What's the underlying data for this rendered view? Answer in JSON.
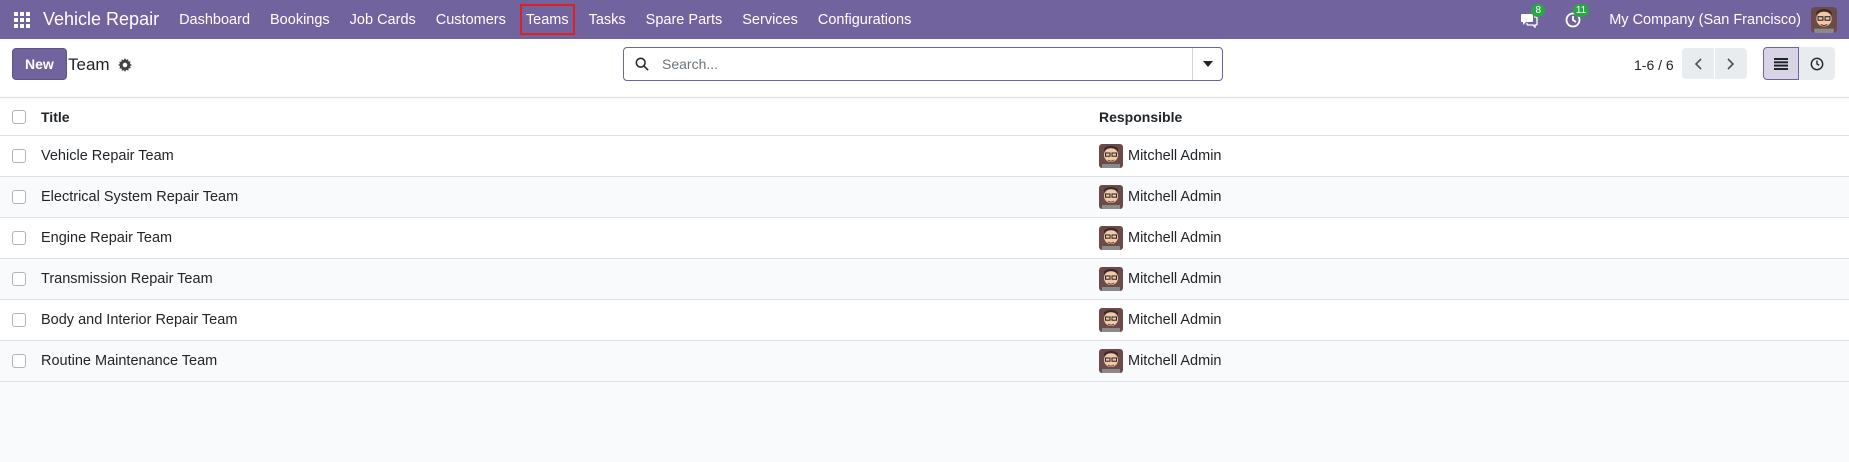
{
  "navbar": {
    "brand": "Vehicle Repair",
    "menu": [
      "Dashboard",
      "Bookings",
      "Job Cards",
      "Customers",
      "Teams",
      "Tasks",
      "Spare Parts",
      "Services",
      "Configurations"
    ],
    "messages_count": "8",
    "activities_count": "11",
    "company": "My Company (San Francisco)"
  },
  "control_panel": {
    "new_label": "New",
    "breadcrumb": "Team",
    "search_placeholder": "Search...",
    "pager": "1-6 / 6"
  },
  "list": {
    "columns": {
      "title": "Title",
      "responsible": "Responsible"
    },
    "rows": [
      {
        "title": "Vehicle Repair Team",
        "responsible": "Mitchell Admin"
      },
      {
        "title": "Electrical System Repair Team",
        "responsible": "Mitchell Admin"
      },
      {
        "title": "Engine Repair Team",
        "responsible": "Mitchell Admin"
      },
      {
        "title": "Transmission Repair Team",
        "responsible": "Mitchell Admin"
      },
      {
        "title": "Body and Interior Repair Team",
        "responsible": "Mitchell Admin"
      },
      {
        "title": "Routine Maintenance Team",
        "responsible": "Mitchell Admin"
      }
    ]
  },
  "colors": {
    "primary": "#71639e",
    "highlight": "#e02020",
    "badge": "#28a745"
  },
  "icons": [
    "apps-grid-icon",
    "chat-icon",
    "clock-icon",
    "gear-icon",
    "search-icon",
    "caret-down-icon",
    "chevron-left-icon",
    "chevron-right-icon",
    "list-view-icon",
    "activity-view-icon"
  ]
}
